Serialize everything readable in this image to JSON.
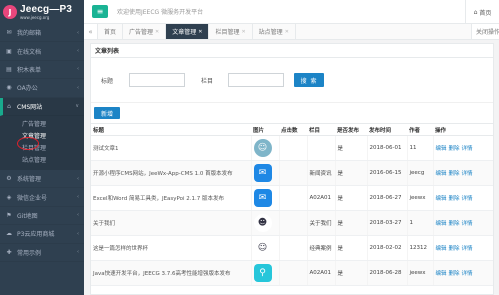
{
  "app": {
    "logo_mark": "J",
    "title": "Jeecg—P3",
    "subtitle": "www.jeecg.org",
    "welcome": "欢迎使用JEECG 微服务开发平台",
    "home_label": "首页"
  },
  "sidebar": {
    "items": [
      {
        "label": "我的邮箱",
        "icon": "✉"
      },
      {
        "label": "在线文档",
        "icon": "▣"
      },
      {
        "label": "积木表单",
        "icon": "▤"
      },
      {
        "label": "OA办公",
        "icon": "◉"
      },
      {
        "label": "CMS网站",
        "icon": "⌂"
      },
      {
        "label": "系统管理",
        "icon": "⚙"
      },
      {
        "label": "微信企业号",
        "icon": "◈"
      },
      {
        "label": "Git地图",
        "icon": "⚑"
      },
      {
        "label": "P3云应用商城",
        "icon": "☁"
      },
      {
        "label": "常用示例",
        "icon": "✚"
      }
    ],
    "cms_submenu": [
      "广告管理",
      "文章管理",
      "栏目管理",
      "站点管理"
    ]
  },
  "tabs": {
    "home": "首页",
    "items": [
      "广告管理",
      "文章管理",
      "栏目管理",
      "站点管理"
    ],
    "right": "关闭操作"
  },
  "panel": {
    "title": "文章列表",
    "label_title": "标题",
    "label_column": "栏目",
    "search_button": "搜 索",
    "new_button": "新增"
  },
  "table": {
    "headers": [
      "标题",
      "图片",
      "点击数",
      "栏目",
      "是否发布",
      "发布时间",
      "作者",
      "操作"
    ],
    "op_edit": "编辑",
    "op_delete": "删除",
    "op_detail": "详情",
    "rows": [
      {
        "title": "测试文章1",
        "clicks": "",
        "column": "",
        "published": "是",
        "date": "2018-06-01",
        "author": "11",
        "thumb": "doctor",
        "thumb_bg": "#7fb5c9"
      },
      {
        "title": "开源小程序CMS网站，JeeWx-App-CMS 1.0 首版本发布",
        "clicks": "",
        "column": "新闻资讯",
        "published": "是",
        "date": "2016-06-15",
        "author": "jeecg",
        "thumb": "mail",
        "thumb_bg": "#1e88e5"
      },
      {
        "title": "Excel和Word 简易工具类，JEasyPoi 2.1.7 版本发布",
        "clicks": "",
        "column": "A02A01",
        "published": "是",
        "date": "2018-06-27",
        "author": "jeewx",
        "thumb": "mail",
        "thumb_bg": "#1e88e5"
      },
      {
        "title": "关于我们",
        "clicks": "",
        "column": "关于我们",
        "published": "是",
        "date": "2018-03-27",
        "author": "1",
        "thumb": "ninja",
        "thumb_bg": "#ffffff"
      },
      {
        "title": "这是一篇怎样的世界杯",
        "clicks": "",
        "column": "经典案例",
        "published": "是",
        "date": "2018-02-02",
        "author": "12312",
        "thumb": "cartoon",
        "thumb_bg": "#ffffff"
      },
      {
        "title": "Java快速开发平台，JEECG 3.7.6高考性能增强版本发布",
        "clicks": "",
        "column": "A02A01",
        "published": "是",
        "date": "2018-06-28",
        "author": "jeewx",
        "thumb": "pin",
        "thumb_bg": "#26c6da"
      }
    ]
  },
  "colors": {
    "sidebar_bg": "#2f4050",
    "accent_green": "#1ab394",
    "primary_blue": "#1c84c6",
    "highlight_red": "#e0202b"
  }
}
